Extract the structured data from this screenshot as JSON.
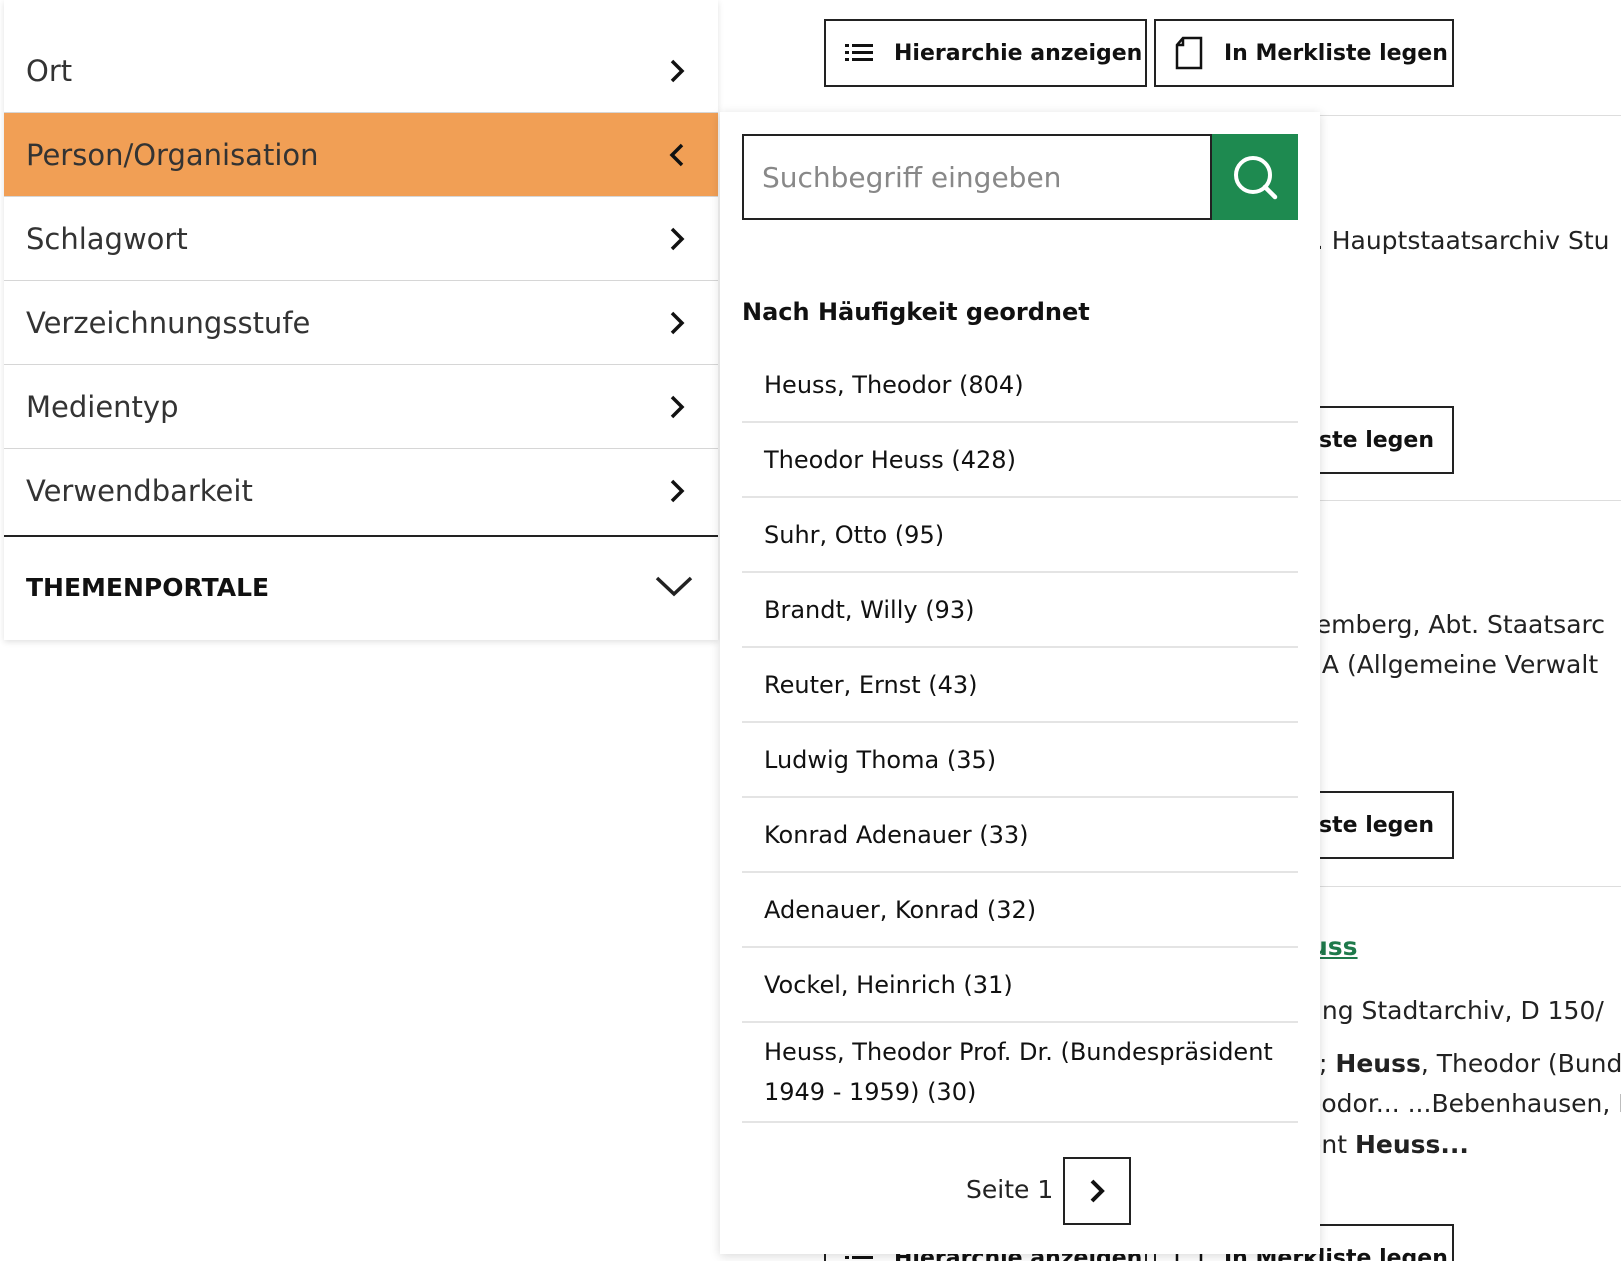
{
  "toolbar": {
    "hierarchy_label": "Hierarchie anzeigen",
    "bookmark_label": "In Merkliste legen"
  },
  "results": {
    "r1_line1": "t. Hauptstaatsarchiv Stu",
    "r1_button": "liste legen",
    "r2_line1": "temberg, Abt. Staatsarc",
    "r2_line2": ". A (Allgemeine Verwalt",
    "r2_button": "liste legen",
    "r3_title": "uss",
    "r3_line1": "ung Stadtarchiv, D 150/",
    "r3_line2a": "s; ",
    "r3_line2b": "Heuss",
    "r3_line2c": ", Theodor (Bunde",
    "r3_line3": "eodor... ...Bebenhausen, I",
    "r3_line4a": "ent ",
    "r3_line4b": "Heuss...",
    "bottom_hierarchy": "Hierarchie anzeigen",
    "bottom_bookmark": "In Merkliste legen"
  },
  "filters": {
    "items": [
      {
        "label": "Ort",
        "state": "collapsed"
      },
      {
        "label": "Person/Organisation",
        "state": "open"
      },
      {
        "label": "Schlagwort",
        "state": "collapsed"
      },
      {
        "label": "Verzeichnungsstufe",
        "state": "collapsed"
      },
      {
        "label": "Medientyp",
        "state": "collapsed"
      },
      {
        "label": "Verwendbarkeit",
        "state": "collapsed"
      }
    ],
    "themenportale": "THEMENPORTALE",
    "active_color": "#f19f55"
  },
  "dropdown": {
    "search_placeholder": "Suchbegriff eingeben",
    "search_value": "",
    "search_button_color": "#1e8a50",
    "sort_title": "Nach Häufigkeit geordnet",
    "entries": [
      "Heuss, Theodor (804)",
      "Theodor Heuss (428)",
      "Suhr, Otto (95)",
      "Brandt, Willy (93)",
      "Reuter, Ernst (43)",
      "Ludwig Thoma (35)",
      "Konrad Adenauer (33)",
      "Adenauer, Konrad (32)",
      "Vockel, Heinrich (31)",
      "Heuss, Theodor Prof. Dr. (Bundespräsident 1949 - 1959) (30)"
    ],
    "page_label": "Seite 1"
  }
}
